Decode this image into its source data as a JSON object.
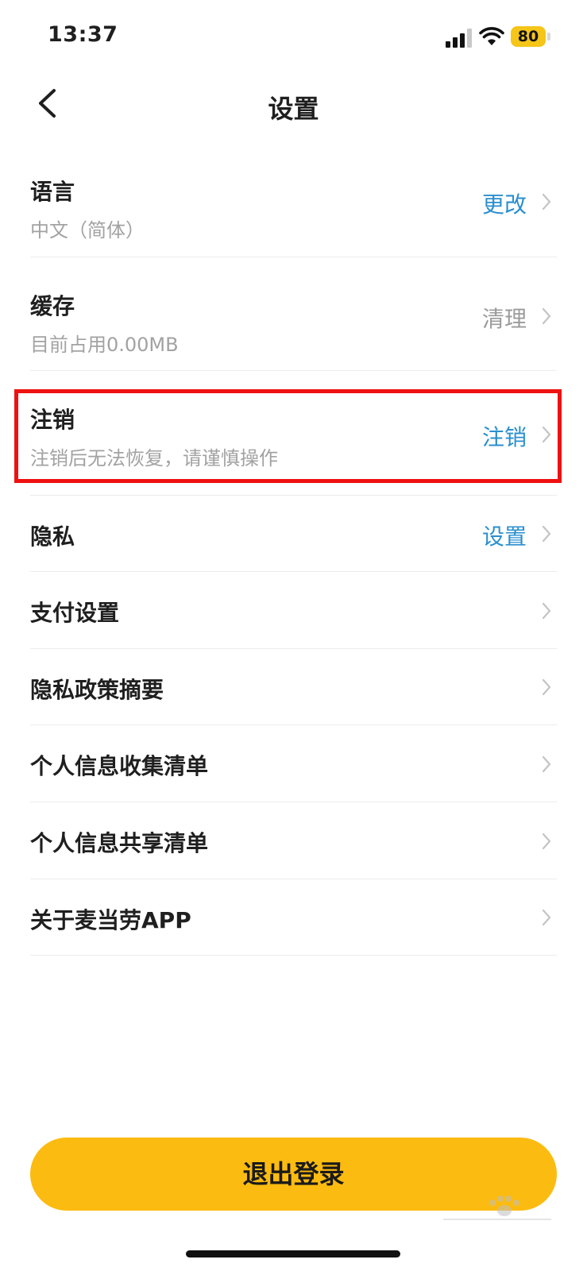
{
  "status_bar": {
    "time": "13:37",
    "battery": "80"
  },
  "navbar": {
    "title": "设置",
    "back_icon": "chevron-left-icon"
  },
  "settings": [
    {
      "title": "语言",
      "subtitle": "中文（简体）",
      "action": "更改",
      "action_color": "#2b8fce"
    },
    {
      "title": "缓存",
      "subtitle": "目前占用0.00MB",
      "action": "清理",
      "action_color": "#9b9b9b"
    },
    {
      "title": "注销",
      "subtitle": "注销后无法恢复，请谨慎操作",
      "action": "注销",
      "action_color": "#2b8fce"
    },
    {
      "title": "隐私",
      "action": "设置",
      "action_color": "#2b8fce"
    },
    {
      "title": "支付设置"
    },
    {
      "title": "隐私政策摘要"
    },
    {
      "title": "个人信息收集清单"
    },
    {
      "title": "个人信息共享清单"
    },
    {
      "title": "关于麦当劳APP"
    }
  ],
  "logout_button": {
    "label": "退出登录",
    "color": "#fcbb10"
  },
  "highlight_color": "#ee1111",
  "watermark": "Baidu经验"
}
